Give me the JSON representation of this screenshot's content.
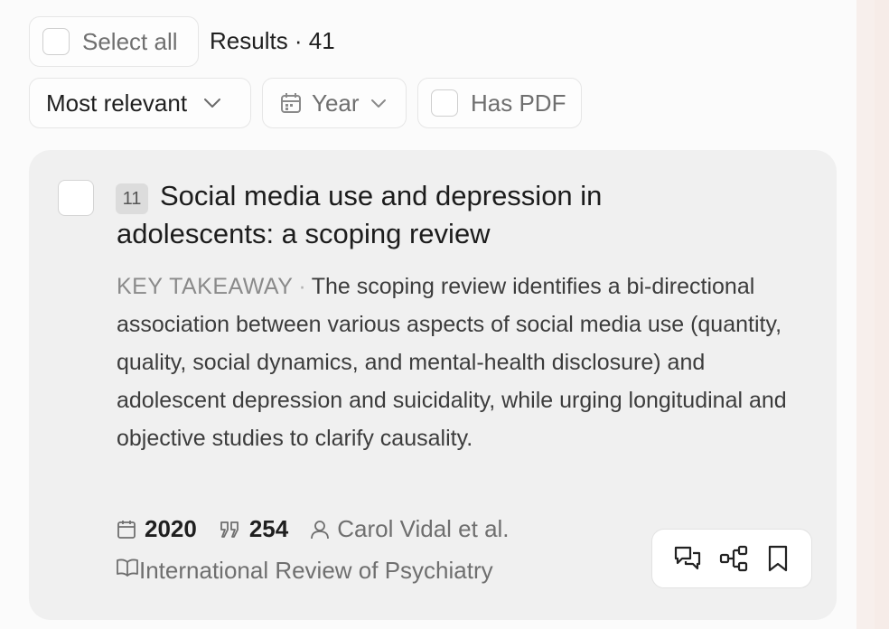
{
  "toolbar": {
    "select_all_label": "Select all",
    "results_label": "Results · 41"
  },
  "filters": {
    "sort_label": "Most relevant",
    "year_label": "Year",
    "has_pdf_label": "Has PDF"
  },
  "result": {
    "rank": "11",
    "title": "Social media use and depression in adolescents: a scoping review",
    "takeaway_label": "KEY TAKEAWAY",
    "takeaway_sep": "·",
    "takeaway_text": "The scoping review identifies a bi-directional association between various aspects of social media use (quantity, quality, social dynamics, and mental-health disclosure) and adolescent depression and suicidality, while urging longitudinal and objective studies to clarify causality.",
    "year": "2020",
    "citations": "254",
    "authors": "Carol Vidal et al.",
    "journal": "International Review of Psychiatry"
  },
  "icons": {
    "calendar": "calendar-icon",
    "quote": "quote-icon",
    "person": "person-icon",
    "book": "book-icon",
    "chat": "chat-icon",
    "share": "share-icon",
    "bookmark": "bookmark-icon",
    "chevron": "chevron-down-icon"
  }
}
